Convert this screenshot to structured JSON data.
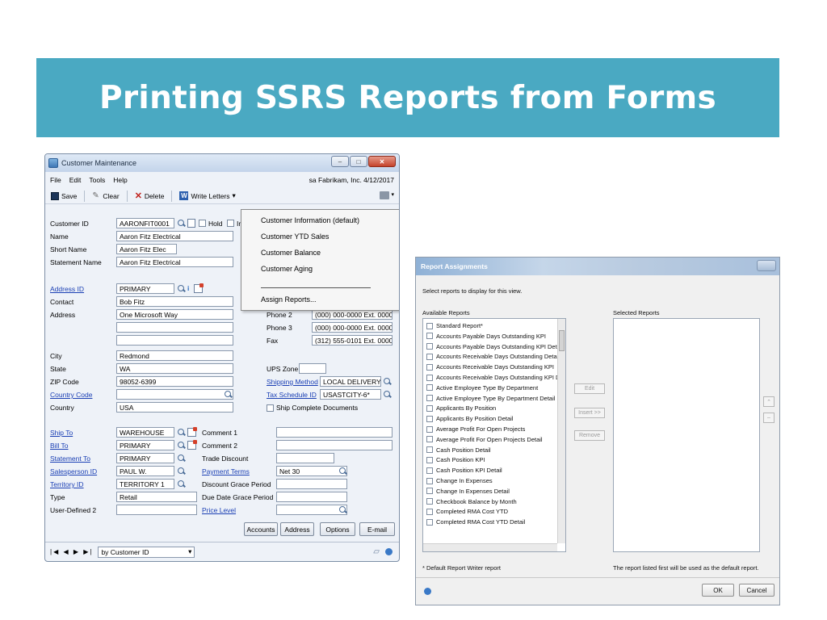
{
  "slide": {
    "title": "Printing SSRS Reports from Forms"
  },
  "customer_window": {
    "title": "Customer Maintenance",
    "menu": [
      "File",
      "Edit",
      "Tools",
      "Help"
    ],
    "status_text": "sa  Fabrikam, Inc.  4/12/2017",
    "toolbar": {
      "save": "Save",
      "clear": "Clear",
      "delete": "Delete",
      "write_letters": "Write Letters"
    },
    "fields": {
      "customer_id_label": "Customer ID",
      "customer_id_value": "AARONFIT0001",
      "hold_label": "Hold",
      "inactive_label": "In",
      "name_label": "Name",
      "name_value": "Aaron Fitz Electrical",
      "short_name_label": "Short Name",
      "short_name_value": "Aaron Fitz Elec",
      "statement_name_label": "Statement Name",
      "statement_name_value": "Aaron Fitz Electrical",
      "address_id_label": "Address ID",
      "address_id_value": "PRIMARY",
      "contact_label": "Contact",
      "contact_value": "Bob Fitz",
      "address_label": "Address",
      "address_value": "One Microsoft Way",
      "city_label": "City",
      "city_value": "Redmond",
      "state_label": "State",
      "state_value": "WA",
      "zip_label": "ZIP Code",
      "zip_value": "98052-6399",
      "country_code_label": "Country Code",
      "country_label": "Country",
      "country_value": "USA",
      "phone2_label": "Phone 2",
      "phone2_value": "(000) 000-0000 Ext. 0000",
      "phone3_label": "Phone 3",
      "phone3_value": "(000) 000-0000 Ext. 0000",
      "fax_label": "Fax",
      "fax_value": "(312) 555-0101 Ext. 0000",
      "ups_zone_label": "UPS Zone",
      "shipping_method_label": "Shipping Method",
      "shipping_method_value": "LOCAL DELIVERY",
      "tax_schedule_label": "Tax Schedule ID",
      "tax_schedule_value": "USASTCITY-6*",
      "ship_complete_label": "Ship Complete Documents",
      "ship_to_label": "Ship To",
      "ship_to_value": "WAREHOUSE",
      "bill_to_label": "Bill To",
      "bill_to_value": "PRIMARY",
      "statement_to_label": "Statement To",
      "statement_to_value": "PRIMARY",
      "salesperson_label": "Salesperson ID",
      "salesperson_value": "PAUL W.",
      "territory_label": "Territory ID",
      "territory_value": "TERRITORY 1",
      "type_label": "Type",
      "type_value": "Retail",
      "user_defined_label": "User-Defined 2",
      "comment1_label": "Comment 1",
      "comment2_label": "Comment 2",
      "trade_discount_label": "Trade Discount",
      "payment_terms_label": "Payment Terms",
      "payment_terms_value": "Net 30",
      "discount_grace_label": "Discount Grace Period",
      "due_date_grace_label": "Due Date Grace Period",
      "price_level_label": "Price Level"
    },
    "dropdown_menu": {
      "items": [
        "Customer Information (default)",
        "Customer YTD Sales",
        "Customer Balance",
        "Customer Aging"
      ],
      "assign": "Assign Reports..."
    },
    "buttons": {
      "accounts": "Accounts",
      "address": "Address",
      "options": "Options",
      "email": "E-mail"
    },
    "statusbar": {
      "sort_prefix": "by",
      "sort_value": "by Customer ID"
    }
  },
  "report_window": {
    "title": "Report Assignments",
    "instruction": "Select reports to display for this view.",
    "available_label": "Available Reports",
    "selected_label": "Selected Reports",
    "available_reports": [
      "Standard Report*",
      "Accounts Payable Days Outstanding KPI",
      "Accounts Payable Days Outstanding KPI Detail",
      "Accounts Receivable Days Outstanding Detail",
      "Accounts Receivable Days Outstanding KPI",
      "Accounts Receivable Days Outstanding KPI Detail",
      "Active Employee Type By Department",
      "Active Employee Type By Department Detail",
      "Applicants By Position",
      "Applicants By Position Detail",
      "Average Profit For Open Projects",
      "Average Profit For Open Projects Detail",
      "Cash Position Detail",
      "Cash Position KPI",
      "Cash Position KPI Detail",
      "Change In Expenses",
      "Change In Expenses Detail",
      "Checkbook Balance by Month",
      "Completed RMA Cost YTD",
      "Completed RMA Cost YTD Detail"
    ],
    "buttons": {
      "edit": "Edit",
      "insert": "Insert >>",
      "remove": "Remove",
      "ok": "OK",
      "cancel": "Cancel"
    },
    "footnote_left": "* Default Report Writer report",
    "footnote_right": "The report listed first will be used as the default report."
  }
}
